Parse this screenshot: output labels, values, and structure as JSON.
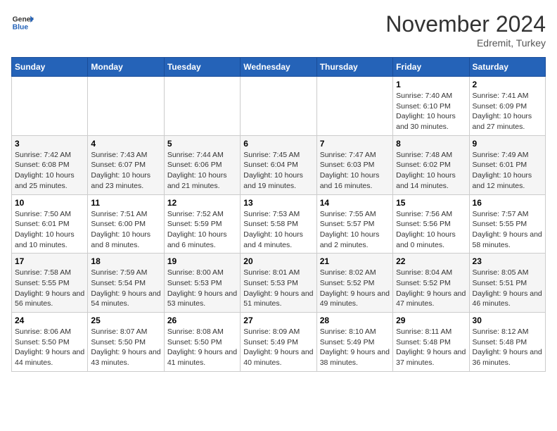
{
  "header": {
    "logo_general": "General",
    "logo_blue": "Blue",
    "month_title": "November 2024",
    "location": "Edremit, Turkey"
  },
  "days_of_week": [
    "Sunday",
    "Monday",
    "Tuesday",
    "Wednesday",
    "Thursday",
    "Friday",
    "Saturday"
  ],
  "weeks": [
    [
      {
        "day": "",
        "info": ""
      },
      {
        "day": "",
        "info": ""
      },
      {
        "day": "",
        "info": ""
      },
      {
        "day": "",
        "info": ""
      },
      {
        "day": "",
        "info": ""
      },
      {
        "day": "1",
        "info": "Sunrise: 7:40 AM\nSunset: 6:10 PM\nDaylight: 10 hours and 30 minutes."
      },
      {
        "day": "2",
        "info": "Sunrise: 7:41 AM\nSunset: 6:09 PM\nDaylight: 10 hours and 27 minutes."
      }
    ],
    [
      {
        "day": "3",
        "info": "Sunrise: 7:42 AM\nSunset: 6:08 PM\nDaylight: 10 hours and 25 minutes."
      },
      {
        "day": "4",
        "info": "Sunrise: 7:43 AM\nSunset: 6:07 PM\nDaylight: 10 hours and 23 minutes."
      },
      {
        "day": "5",
        "info": "Sunrise: 7:44 AM\nSunset: 6:06 PM\nDaylight: 10 hours and 21 minutes."
      },
      {
        "day": "6",
        "info": "Sunrise: 7:45 AM\nSunset: 6:04 PM\nDaylight: 10 hours and 19 minutes."
      },
      {
        "day": "7",
        "info": "Sunrise: 7:47 AM\nSunset: 6:03 PM\nDaylight: 10 hours and 16 minutes."
      },
      {
        "day": "8",
        "info": "Sunrise: 7:48 AM\nSunset: 6:02 PM\nDaylight: 10 hours and 14 minutes."
      },
      {
        "day": "9",
        "info": "Sunrise: 7:49 AM\nSunset: 6:01 PM\nDaylight: 10 hours and 12 minutes."
      }
    ],
    [
      {
        "day": "10",
        "info": "Sunrise: 7:50 AM\nSunset: 6:01 PM\nDaylight: 10 hours and 10 minutes."
      },
      {
        "day": "11",
        "info": "Sunrise: 7:51 AM\nSunset: 6:00 PM\nDaylight: 10 hours and 8 minutes."
      },
      {
        "day": "12",
        "info": "Sunrise: 7:52 AM\nSunset: 5:59 PM\nDaylight: 10 hours and 6 minutes."
      },
      {
        "day": "13",
        "info": "Sunrise: 7:53 AM\nSunset: 5:58 PM\nDaylight: 10 hours and 4 minutes."
      },
      {
        "day": "14",
        "info": "Sunrise: 7:55 AM\nSunset: 5:57 PM\nDaylight: 10 hours and 2 minutes."
      },
      {
        "day": "15",
        "info": "Sunrise: 7:56 AM\nSunset: 5:56 PM\nDaylight: 10 hours and 0 minutes."
      },
      {
        "day": "16",
        "info": "Sunrise: 7:57 AM\nSunset: 5:55 PM\nDaylight: 9 hours and 58 minutes."
      }
    ],
    [
      {
        "day": "17",
        "info": "Sunrise: 7:58 AM\nSunset: 5:55 PM\nDaylight: 9 hours and 56 minutes."
      },
      {
        "day": "18",
        "info": "Sunrise: 7:59 AM\nSunset: 5:54 PM\nDaylight: 9 hours and 54 minutes."
      },
      {
        "day": "19",
        "info": "Sunrise: 8:00 AM\nSunset: 5:53 PM\nDaylight: 9 hours and 53 minutes."
      },
      {
        "day": "20",
        "info": "Sunrise: 8:01 AM\nSunset: 5:53 PM\nDaylight: 9 hours and 51 minutes."
      },
      {
        "day": "21",
        "info": "Sunrise: 8:02 AM\nSunset: 5:52 PM\nDaylight: 9 hours and 49 minutes."
      },
      {
        "day": "22",
        "info": "Sunrise: 8:04 AM\nSunset: 5:52 PM\nDaylight: 9 hours and 47 minutes."
      },
      {
        "day": "23",
        "info": "Sunrise: 8:05 AM\nSunset: 5:51 PM\nDaylight: 9 hours and 46 minutes."
      }
    ],
    [
      {
        "day": "24",
        "info": "Sunrise: 8:06 AM\nSunset: 5:50 PM\nDaylight: 9 hours and 44 minutes."
      },
      {
        "day": "25",
        "info": "Sunrise: 8:07 AM\nSunset: 5:50 PM\nDaylight: 9 hours and 43 minutes."
      },
      {
        "day": "26",
        "info": "Sunrise: 8:08 AM\nSunset: 5:50 PM\nDaylight: 9 hours and 41 minutes."
      },
      {
        "day": "27",
        "info": "Sunrise: 8:09 AM\nSunset: 5:49 PM\nDaylight: 9 hours and 40 minutes."
      },
      {
        "day": "28",
        "info": "Sunrise: 8:10 AM\nSunset: 5:49 PM\nDaylight: 9 hours and 38 minutes."
      },
      {
        "day": "29",
        "info": "Sunrise: 8:11 AM\nSunset: 5:48 PM\nDaylight: 9 hours and 37 minutes."
      },
      {
        "day": "30",
        "info": "Sunrise: 8:12 AM\nSunset: 5:48 PM\nDaylight: 9 hours and 36 minutes."
      }
    ]
  ]
}
